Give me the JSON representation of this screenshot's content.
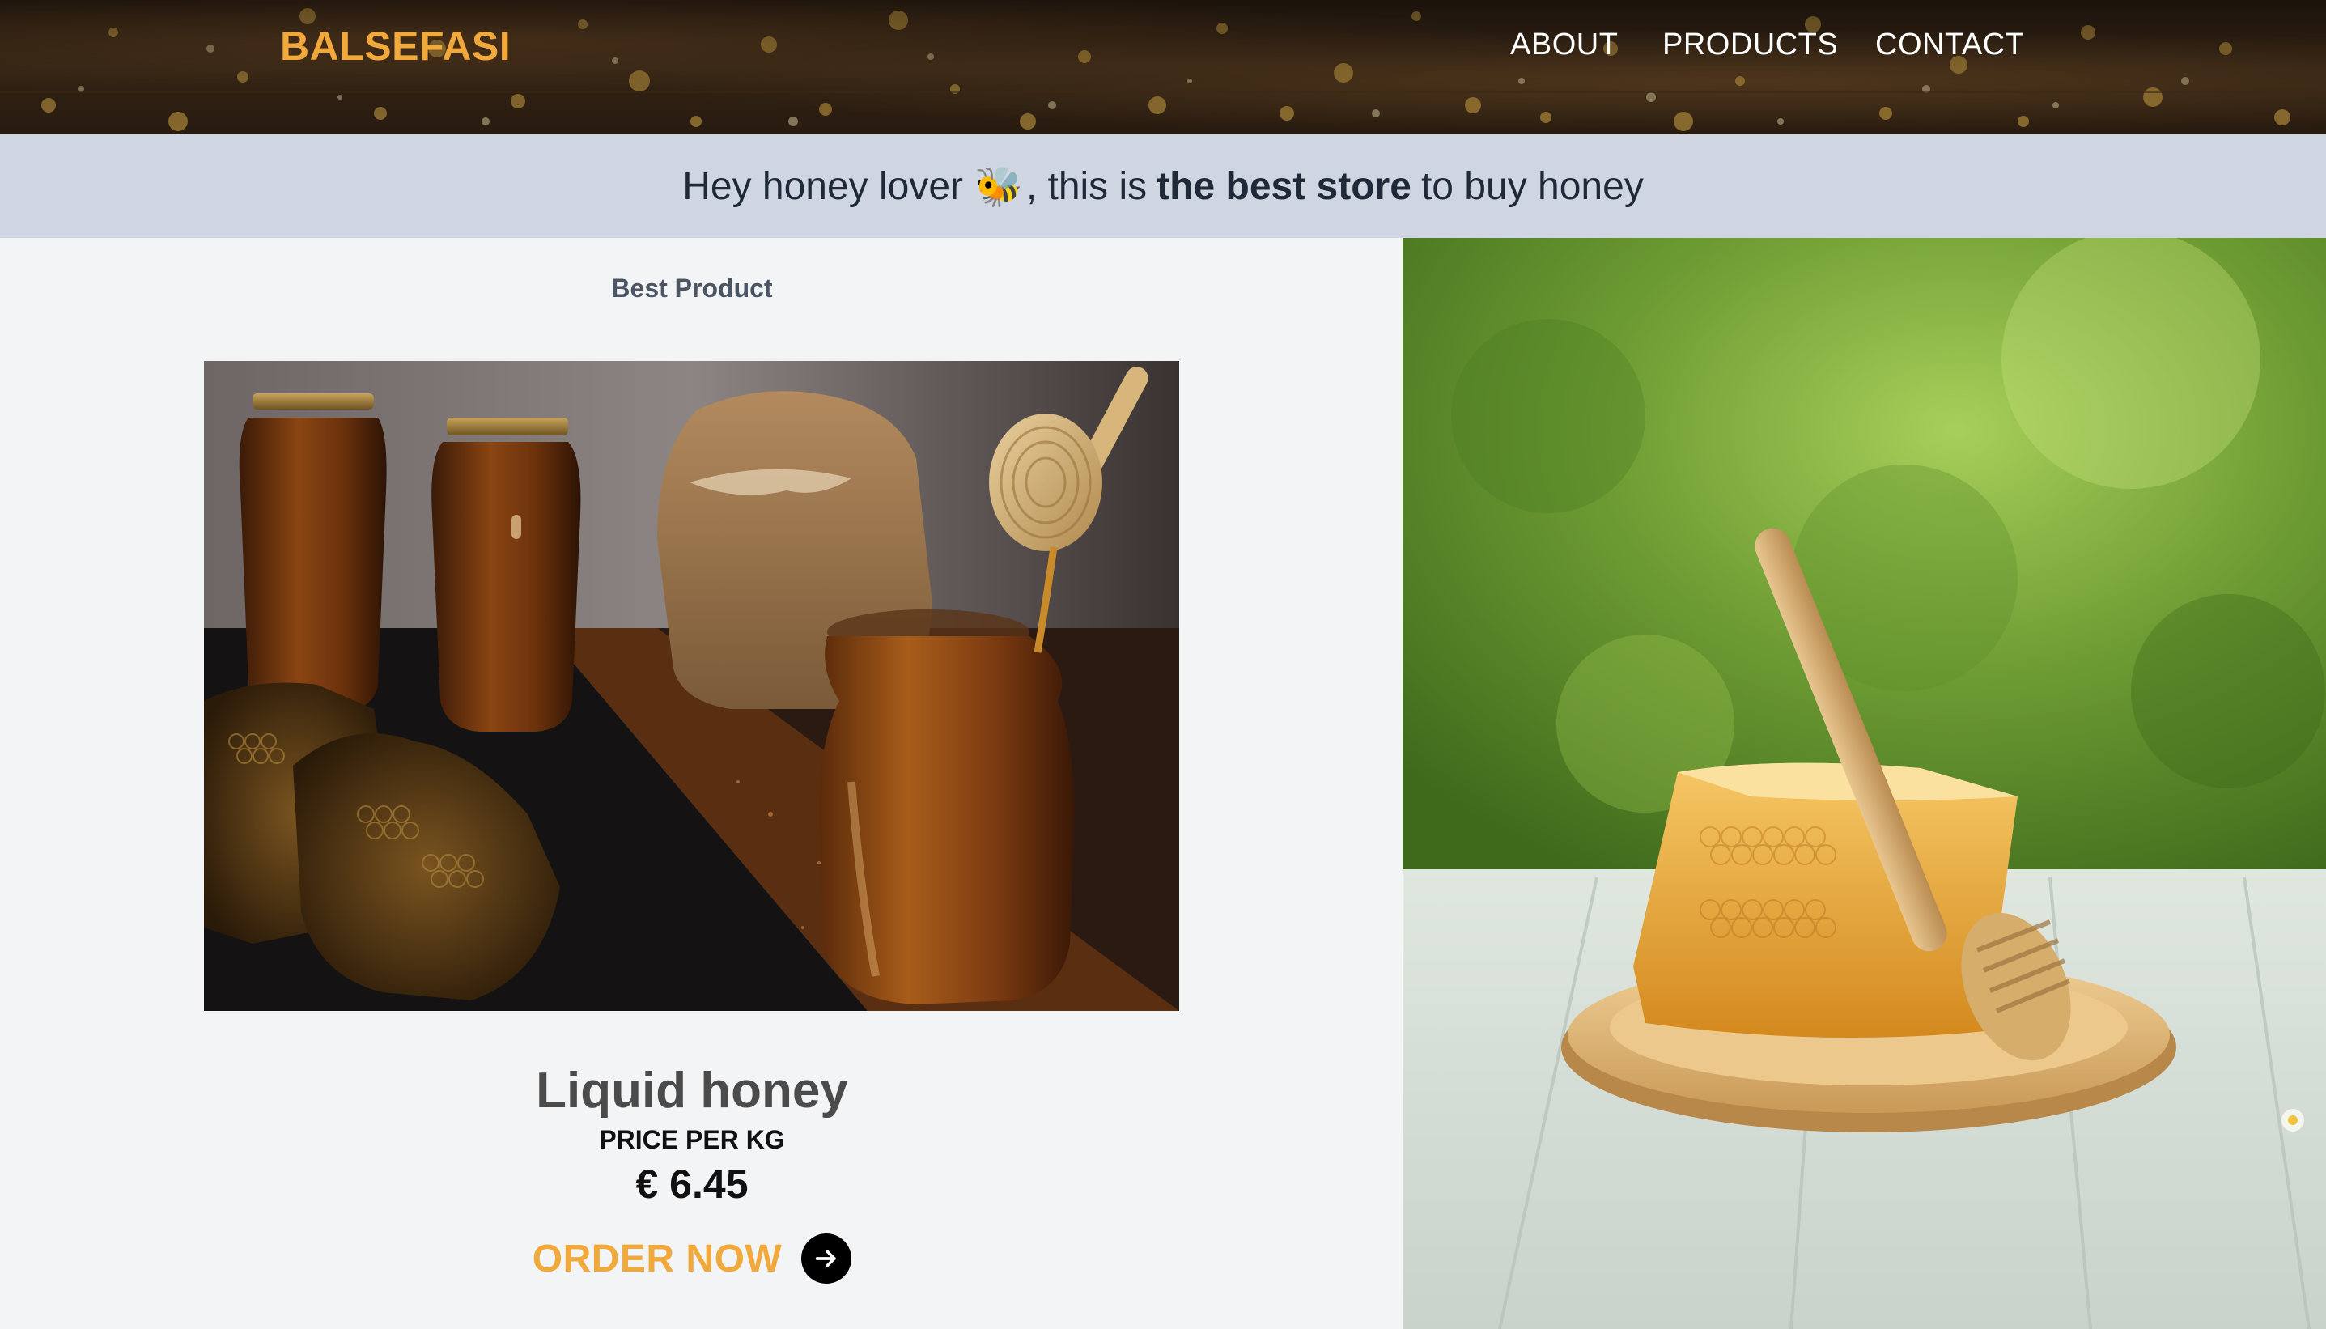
{
  "nav": {
    "brand": "BALSEFASI",
    "links": [
      "ABOUT",
      "PRODUCTS",
      "CONTACT"
    ]
  },
  "banner": {
    "text_before": "Hey honey lover",
    "emoji": "🐝",
    "text_middle": ", this is",
    "text_bold": "the best store",
    "text_after": "to buy honey"
  },
  "featured": {
    "section_label": "Best Product",
    "product_name": "Liquid honey",
    "price_label": "PRICE PER KG",
    "price": "€ 6.45",
    "order_label": "ORDER NOW",
    "order_icon": "arrow-right-icon"
  },
  "colors": {
    "accent": "#f2a93b",
    "banner_bg": "#cfd6e1",
    "page_bg": "#f3f4f6",
    "text_dark": "#1f2937"
  }
}
